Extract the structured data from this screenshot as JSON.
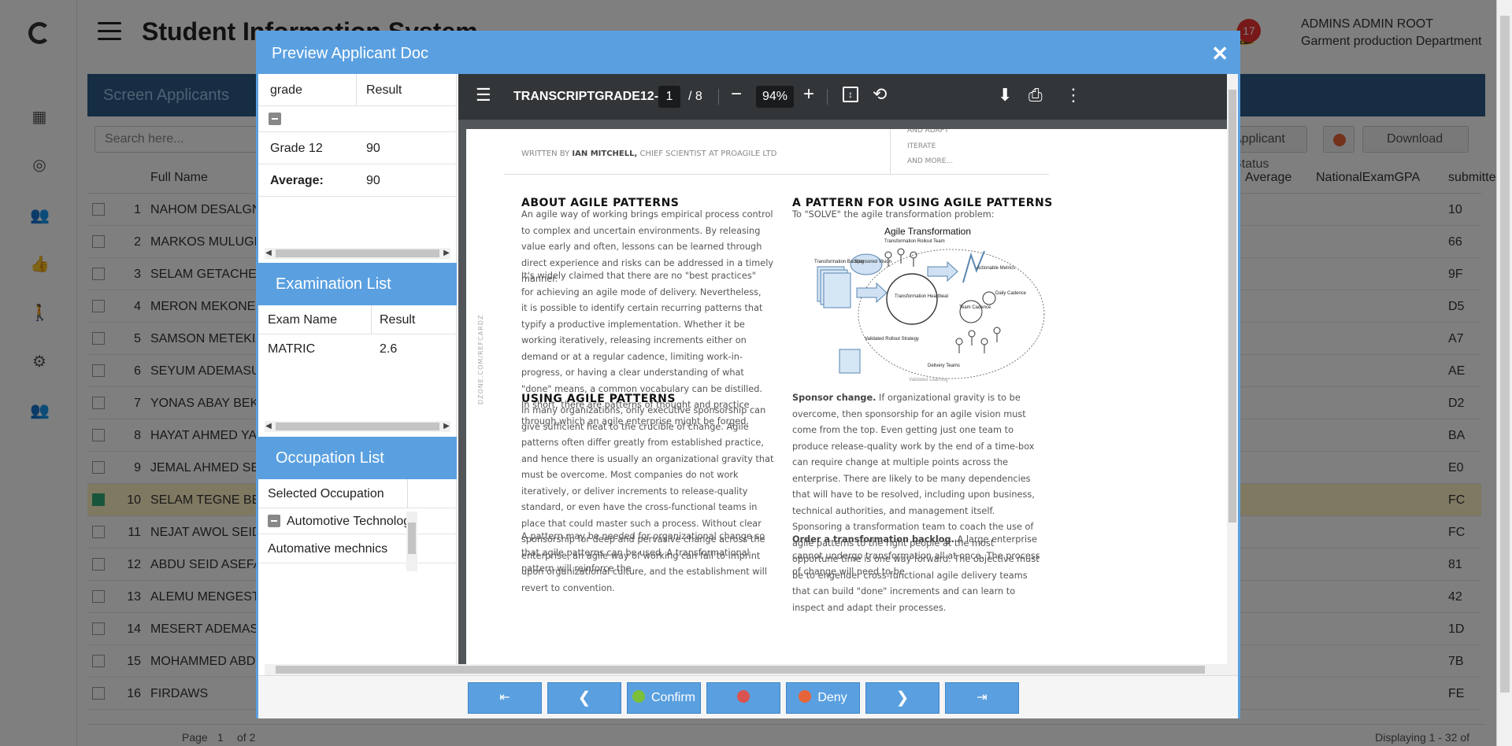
{
  "app": {
    "title": "Student Information System",
    "notification_count": "17",
    "user_name": "ADMINS ADMIN ROOT",
    "user_department": "Garment production Department",
    "panel_title": "Screen Applicants",
    "search_placeholder": "Search here...",
    "status_filter": "Applicant Status",
    "download_label": "Download",
    "columns": {
      "full_name": "Full Name",
      "average": "Average",
      "national_exam_gpa": "NationalExamGPA",
      "submitted": "submitted"
    },
    "rows": [
      {
        "num": "1",
        "name": "NAHOM DESALGNE",
        "sub": "10"
      },
      {
        "num": "2",
        "name": "MARKOS MULUGETA",
        "sub": "66"
      },
      {
        "num": "3",
        "name": "SELAM GETACHEW",
        "sub": "9F"
      },
      {
        "num": "4",
        "name": "MERON MEKONEN",
        "sub": "D5"
      },
      {
        "num": "5",
        "name": "SAMSON METEKIA",
        "sub": "A7"
      },
      {
        "num": "6",
        "name": "SEYUM ADEMASU",
        "sub": "AE"
      },
      {
        "num": "7",
        "name": "YONAS ABAY BEKELE",
        "sub": "D2"
      },
      {
        "num": "8",
        "name": "HAYAT AHMED YASIN",
        "sub": "BA"
      },
      {
        "num": "9",
        "name": "JEMAL AHMED SEID",
        "sub": "E0"
      },
      {
        "num": "10",
        "name": "SELAM TEGNE BELAY",
        "sub": "FC",
        "selected": true
      },
      {
        "num": "11",
        "name": "NEJAT AWOL SEID",
        "sub": "FC"
      },
      {
        "num": "12",
        "name": "ABDU SEID ASEFA",
        "sub": "81"
      },
      {
        "num": "13",
        "name": "ALEMU MENGESTU",
        "sub": "42"
      },
      {
        "num": "14",
        "name": "MESERT ADEMASU",
        "sub": "1D"
      },
      {
        "num": "15",
        "name": "MOHAMMED ABDU",
        "sub": "7B"
      },
      {
        "num": "16",
        "name": "FIRDAWS",
        "sub": "FE"
      }
    ],
    "pager": {
      "page_label": "Page",
      "page": "1",
      "of": "of 2",
      "displaying": "Displaying 1 - 32 of"
    }
  },
  "dialog": {
    "title": "Preview Applicant Doc",
    "grade_table": {
      "headers": [
        "grade",
        "Result"
      ],
      "rows": [
        {
          "grade": "Grade 12",
          "result": "90"
        },
        {
          "grade": "Average:",
          "result": "90"
        }
      ]
    },
    "exam_section_title": "Examination List",
    "exam_table": {
      "headers": [
        "Exam Name",
        "Result"
      ],
      "rows": [
        {
          "name": "MATRIC",
          "result": "2.6"
        }
      ]
    },
    "occupation_section_title": "Occupation List",
    "occupation_table": {
      "header": "Selected Occupation",
      "group": "Automotive Technology",
      "items": [
        "Automative mechnics"
      ]
    },
    "pdf": {
      "filename": "TRANSCRIPTGRADE12-...",
      "page": "1",
      "total_pages": "/ 8",
      "zoom": "94%",
      "doc": {
        "toc_items": [
          "AND ADAPT",
          "ITERATE",
          "AND MORE..."
        ],
        "byline_prefix": "WRITTEN BY ",
        "byline_author": "IAN MITCHELL,",
        "byline_suffix": " CHIEF SCIENTIST AT PROAGILE LTD",
        "side_text": "DZONE.COM/REFCARDZ",
        "h_about": "ABOUT AGILE PATTERNS",
        "p_about1": "An agile way of working brings empirical process control to complex and uncertain environments. By releasing value early and often, lessons can be learned through direct experience and risks can be addressed in a timely manner.",
        "p_about2": "It's widely claimed that there are no \"best practices\" for achieving an agile mode of delivery. Nevertheless, it is possible to identify certain recurring patterns that typify a productive implementation. Whether it be working iteratively, releasing increments either on demand or at a regular cadence, limiting work-in-progress, or having a clear understanding of what \"done\" means, a common vocabulary can be distilled. In short, there are patterns of thought and practice through which an agile enterprise might be forged.",
        "h_using": "USING AGILE PATTERNS",
        "p_using1": "In many organizations, only executive sponsorship can give sufficient heat to the crucible of change. Agile patterns often differ greatly from established practice, and hence there is usually an organizational gravity that must be overcome. Most companies do not work iteratively, or deliver increments to release-quality standard, or even have the cross-functional teams in place that could master such a process. Without clear sponsorship for deep and pervasive change across the enterprise, an agile way of working can fail to imprint upon organizational culture, and the establishment will revert to convention.",
        "p_using2": "A pattern may be needed for organizational change so that agile patterns can be used. A transformational pattern will reinforce the",
        "h_pattern": "A PATTERN FOR USING AGILE PATTERNS",
        "p_pattern": "To \"SOLVE\" the agile transformation problem:",
        "diagram": {
          "title": "Agile Transformation",
          "labels": {
            "rollout_team": "Transformation Rollout Team",
            "backlog": "Transformation Backlog",
            "vision": "Sponsored Vision",
            "heartbeat": "Transformation Heartbeat",
            "metrics": "Actionable Metrics",
            "daily": "Daily Cadence",
            "team_cadence": "Team Cadence",
            "strategy": "Validated Rollout Strategy",
            "delivery": "Delivery Teams",
            "learning": "Validated Learning"
          }
        },
        "sponsor_bold": "Sponsor change.",
        "sponsor_text": " If organizational gravity is to be overcome, then sponsorship for an agile vision must come from the top. Even getting just one team to produce release-quality work by the end of a time-box can require change at multiple points across the enterprise. There are likely to be many dependencies that will have to be resolved, including upon business, technical authorities, and management itself. Sponsoring a transformation team to coach the use of agile patterns to the right people at the most opportune time is one way forward. The objective must be to engender cross-functional agile delivery teams that can build \"done\" increments and can learn to inspect and adapt their processes.",
        "order_bold": "Order a transformation backlog.",
        "order_text": " A large enterprise cannot undergo transformation all at once. The process of change will need to be"
      }
    },
    "footer": {
      "confirm": "Confirm",
      "deny": "Deny"
    }
  },
  "colors": {
    "dialog_accent": "#5aa0e0",
    "pdf_toolbar": "#323639"
  }
}
